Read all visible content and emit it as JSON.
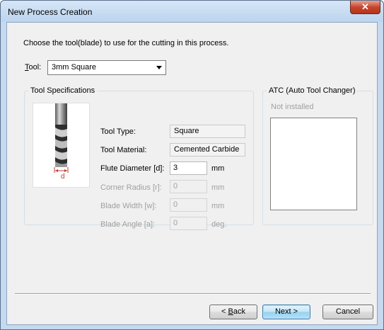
{
  "window": {
    "title": "New Process Creation",
    "close_glyph": "✕"
  },
  "instruction": "Choose the tool(blade) to use for the cutting in this process.",
  "tool": {
    "label_hotkey": "T",
    "label_rest": "ool:",
    "selected": "3mm Square"
  },
  "spec": {
    "legend": "Tool Specifications",
    "diagram_label": "d",
    "tool_type": {
      "label": "Tool Type:",
      "value": "Square"
    },
    "tool_material": {
      "label": "Tool Material:",
      "value": "Cemented Carbide"
    },
    "flute_diameter": {
      "label": "Flute Diameter [d]:",
      "value": "3",
      "unit": "mm"
    },
    "corner_radius": {
      "label": "Corner Radius [r]:",
      "value": "0",
      "unit": "mm"
    },
    "blade_width": {
      "label": "Blade Width [w]:",
      "value": "0",
      "unit": "mm"
    },
    "blade_angle": {
      "label": "Blade Angle [a]:",
      "value": "0",
      "unit": "deg."
    }
  },
  "atc": {
    "legend": "ATC (Auto Tool Changer)",
    "status": "Not installed"
  },
  "buttons": {
    "back_hotkey": "B",
    "back_rest": "ack",
    "back_prefix": "< ",
    "next": "Next >",
    "cancel": "Cancel"
  }
}
